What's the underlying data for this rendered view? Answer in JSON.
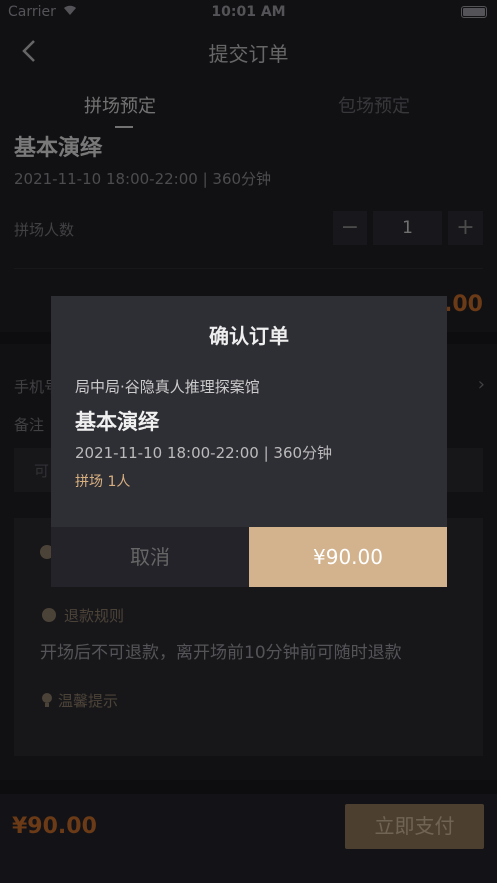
{
  "status_bar": {
    "carrier": "Carrier",
    "time": "10:01 AM"
  },
  "nav": {
    "title": "提交订单"
  },
  "tabs": [
    {
      "label": "拼场预定",
      "active": true
    },
    {
      "label": "包场预定",
      "active": false
    }
  ],
  "show": {
    "title": "基本演绎",
    "time": "2021-11-10 18:00-22:00 | 360分钟"
  },
  "people": {
    "label": "拼场人数",
    "value": "1",
    "minus": "−",
    "plus": "+"
  },
  "price_fragment": ".00",
  "form": {
    "phone_label": "手机号",
    "note_label": "备注",
    "note_placeholder": "可"
  },
  "info": {
    "refund_title": "退款规则",
    "refund_text": "开场后不可退款，离开场前10分钟前可随时退款",
    "tips_title": "温馨提示"
  },
  "footer": {
    "total": "¥90.00",
    "pay_label": "立即支付"
  },
  "modal": {
    "title": "确认订单",
    "venue": "局中局·谷隐真人推理探案馆",
    "show_title": "基本演绎",
    "time": "2021-11-10 18:00-22:00 | 360分钟",
    "tag": "拼场 1人",
    "cancel_label": "取消",
    "confirm_label": "¥90.00"
  },
  "colors": {
    "accent": "#c46a28",
    "gold": "#d2b38e",
    "background": "#1f1f25"
  }
}
